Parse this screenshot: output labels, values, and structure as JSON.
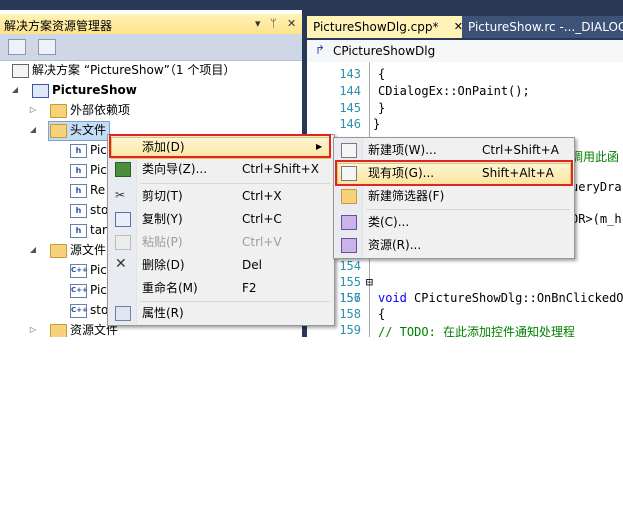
{
  "solution_explorer": {
    "title": "解决方案资源管理器",
    "title_icons": {
      "dropdown": "▾",
      "pin": "ᛘ",
      "close": "✕"
    },
    "tree": {
      "solution": "解决方案 “PictureShow”（1 个项目）",
      "project": "PictureShow",
      "external_deps": "外部依赖项",
      "header_folder": "头文件",
      "header_files": [
        "Pic",
        "Pic",
        "Re",
        "sto",
        "tar"
      ],
      "source_folder": "源文件",
      "source_files": [
        "Pic",
        "Pic",
        "sto"
      ],
      "resource_folder": "资源文件"
    }
  },
  "editor": {
    "tabs": [
      {
        "label": "PictureShowDlg.cpp*",
        "close": "✕"
      },
      {
        "label": "PictureShow.rc -..._DIALOG"
      }
    ],
    "class_dropdown": "CPictureShowDlg",
    "lines": [
      {
        "num": "143",
        "text": "    {"
      },
      {
        "num": "144",
        "text": "        CDialogEx::OnPaint();"
      },
      {
        "num": "145",
        "text": "    }"
      },
      {
        "num": "146",
        "text": "}"
      },
      {
        "num": "",
        "text": ""
      },
      {
        "num": "",
        "text": "调用此函"
      },
      {
        "num": "",
        "text": ""
      },
      {
        "num": "",
        "text": "ueryDra"
      },
      {
        "num": "",
        "text": ""
      },
      {
        "num": "",
        "text": "OR>(m_h"
      },
      {
        "num": "154",
        "text": ""
      },
      {
        "num": "155",
        "text": ""
      },
      {
        "num": "156",
        "text": ""
      },
      {
        "num": "157",
        "kw": "void ",
        "text": "CPictureShowDlg::OnBnClickedOp"
      },
      {
        "num": "158",
        "text": "{"
      },
      {
        "num": "159",
        "comment": "    // TODO: 在此添加控件通知处理程"
      }
    ]
  },
  "context_menu": {
    "items": [
      {
        "label": "添加(D)",
        "shortcut": "",
        "submenu_arrow": "▶"
      },
      {
        "label": "类向导(Z)...",
        "shortcut": "Ctrl+Shift+X"
      },
      {
        "label": "剪切(T)",
        "shortcut": "Ctrl+X"
      },
      {
        "label": "复制(Y)",
        "shortcut": "Ctrl+C"
      },
      {
        "label": "粘贴(P)",
        "shortcut": "Ctrl+V"
      },
      {
        "label": "删除(D)",
        "shortcut": "Del"
      },
      {
        "label": "重命名(M)",
        "shortcut": "F2"
      },
      {
        "label": "属性(R)",
        "shortcut": ""
      }
    ]
  },
  "add_submenu": {
    "items": [
      {
        "label": "新建项(W)...",
        "shortcut": "Ctrl+Shift+A"
      },
      {
        "label": "现有项(G)...",
        "shortcut": "Shift+Alt+A"
      },
      {
        "label": "新建筛选器(F)",
        "shortcut": ""
      },
      {
        "label": "类(C)...",
        "shortcut": ""
      },
      {
        "label": "资源(R)...",
        "shortcut": ""
      }
    ]
  },
  "colors": {
    "ide_frame": "#293955",
    "active_tab": "#fff3b8",
    "highlight_box": "#e02424",
    "keyword": "#0000ff",
    "comment": "#008000",
    "line_number": "#2b91af"
  }
}
